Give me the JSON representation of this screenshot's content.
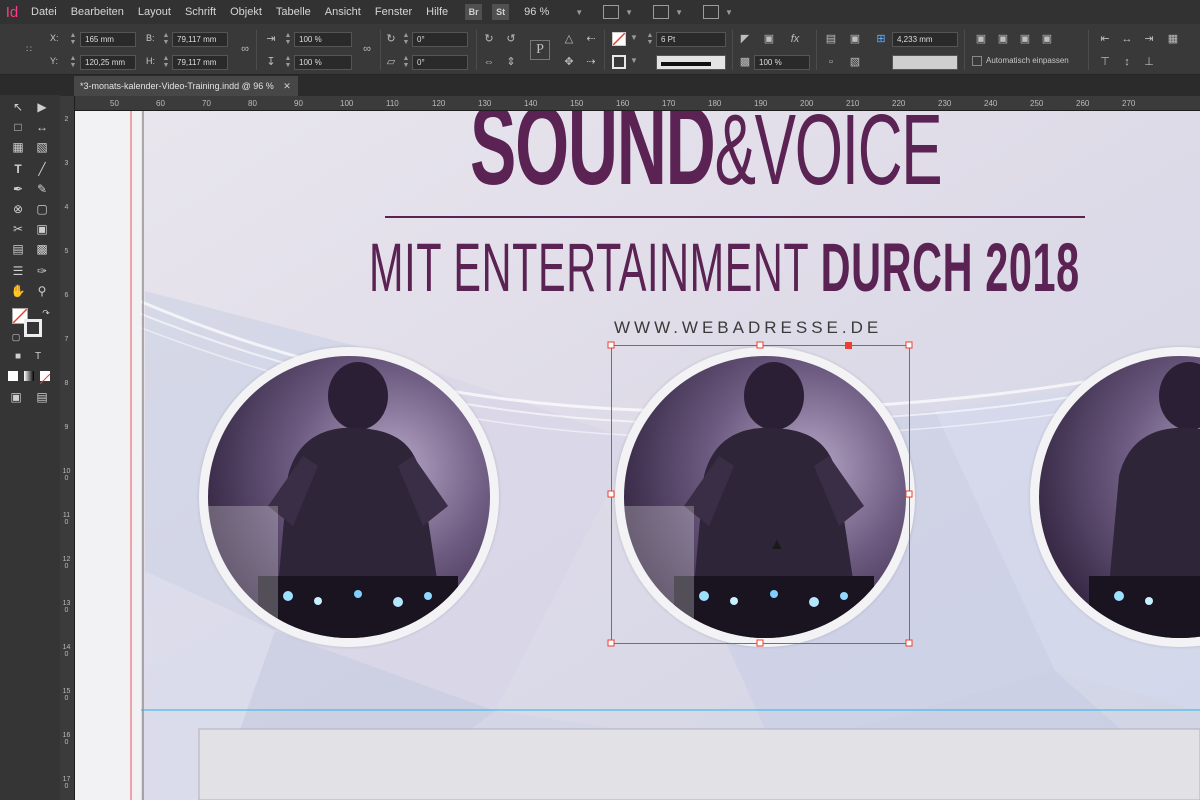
{
  "app": {
    "logo": "Id"
  },
  "menubar": {
    "items": [
      "Datei",
      "Bearbeiten",
      "Layout",
      "Schrift",
      "Objekt",
      "Tabelle",
      "Ansicht",
      "Fenster",
      "Hilfe"
    ],
    "bridge": "Br",
    "stock": "St",
    "zoom": "96 %"
  },
  "control": {
    "x_label": "X:",
    "x_value": "165 mm",
    "y_label": "Y:",
    "y_value": "120,25 mm",
    "w_label": "B:",
    "w_value": "79,117 mm",
    "h_label": "H:",
    "h_value": "79,117 mm",
    "scale_x": "100 %",
    "scale_y": "100 %",
    "rotate": "0°",
    "shear": "0°",
    "stroke_weight": "6 Pt",
    "opacity": "100 %",
    "offset": "4,233 mm",
    "autofit_label": "Automatisch einpassen"
  },
  "document": {
    "tab_title": "*3-monats-kalender-Video-Training.indd @ 96 %"
  },
  "ruler": {
    "h_ticks": [
      "50",
      "60",
      "70",
      "80",
      "90",
      "100",
      "110",
      "120",
      "130",
      "140",
      "150",
      "160",
      "170",
      "180",
      "190",
      "200",
      "210",
      "220",
      "230",
      "240",
      "250",
      "260",
      "270"
    ],
    "h_ticks_left": [
      "0",
      "0",
      "0"
    ],
    "v_ticks": [
      "2",
      "3",
      "4",
      "5",
      "6",
      "7",
      "8",
      "9",
      "100",
      "110",
      "120",
      "130",
      "140",
      "150",
      "160",
      "170"
    ]
  },
  "page": {
    "title_bold": "SOUND",
    "title_light": "&VOICE",
    "subtitle_light": "MIT ENTERTAINMENT ",
    "subtitle_bold": "DURCH 2018",
    "url": "WWW.WEBADRESSE.DE",
    "colors": {
      "title": "#5a2353",
      "selection": "#e8412f",
      "guide": "#27b6e6"
    }
  }
}
